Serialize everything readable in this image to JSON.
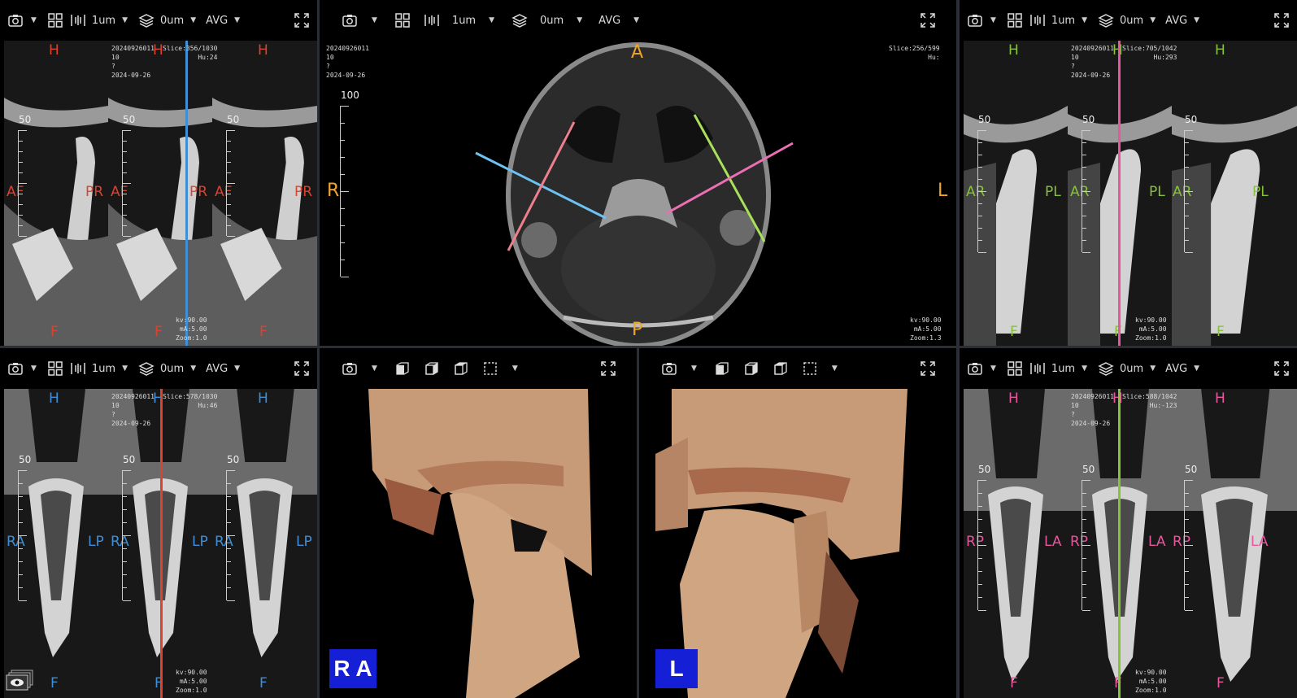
{
  "toolbar_common": {
    "thickness": "1um",
    "layer_value": "0um",
    "mode": "AVG"
  },
  "pane_tl": {
    "orient": {
      "top": "H",
      "bottom": "F",
      "left": "AF",
      "right": "PR"
    },
    "color": "#d9432f",
    "info_left": "20240926011\n10\n?\n2024-09-26",
    "info_right": "Slice:356/1030\nHu:24",
    "exposure": "kv:90.00\nmA:5.00\nZoom:1.0",
    "ruler_label": "50",
    "crossline_color": "#3e8fd6"
  },
  "pane_tc": {
    "orient": {
      "top": "A",
      "bottom": "P",
      "left": "R",
      "right": "L"
    },
    "color": "#f0a52b",
    "info_left": "20240926011\n10\n?\n2024-09-26",
    "info_right": "Slice:256/599\nHu:",
    "exposure": "kv:90.00\nmA:5.00\nZoom:1.3",
    "ruler_label": "100"
  },
  "pane_tr": {
    "orient": {
      "top": "H",
      "bottom": "F",
      "left": "AR",
      "right": "PL"
    },
    "color": "#86c23a",
    "info_left": "20240926011\n10\n?\n2024-09-26",
    "info_right": "Slice:705/1042\nHu:293",
    "exposure": "kv:90.00\nmA:5.00\nZoom:1.0",
    "ruler_label": "50",
    "crossline_color": "#e8579c"
  },
  "pane_bl": {
    "orient": {
      "top": "H",
      "bottom": "F",
      "left": "RA",
      "right": "LP"
    },
    "color": "#3e8fd6",
    "info_left": "20240926011\n10\n?\n2024-09-26",
    "info_right": "Slice:578/1030\nHu:46",
    "exposure": "kv:90.00\nmA:5.00\nZoom:1.0",
    "ruler_label": "50",
    "crossline_color": "#d9432f"
  },
  "pane_bc1": {
    "cube_text": "R A"
  },
  "pane_bc2": {
    "cube_text": "L"
  },
  "pane_br": {
    "orient": {
      "top": "H",
      "bottom": "F",
      "left": "RP",
      "right": "LA"
    },
    "color": "#e8579c",
    "info_left": "20240926011\n10\n?\n2024-09-26",
    "info_right": "Slice:588/1042\nHu:-123",
    "exposure": "kv:90.00\nmA:5.00\nZoom:1.0",
    "ruler_label": "50",
    "crossline_color": "#86c23a"
  },
  "icons": [
    "camera-icon",
    "grid-layout-icon",
    "slice-thickness-icon",
    "layers-icon",
    "fullscreen-icon",
    "cube-front-icon",
    "cube-side-icon",
    "cube-top-icon",
    "crop-select-icon",
    "eye-icon"
  ]
}
